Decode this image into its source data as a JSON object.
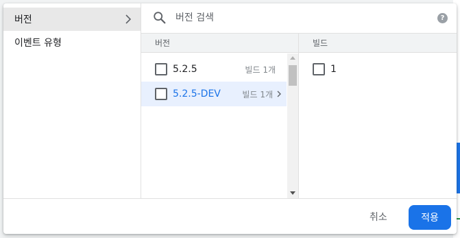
{
  "left_panel": {
    "items": [
      {
        "label": "버전"
      },
      {
        "label": "이벤트 유형"
      }
    ]
  },
  "search": {
    "placeholder": "버전 검색",
    "value": "",
    "help_glyph": "?"
  },
  "version_column": {
    "header": "버전",
    "rows": [
      {
        "label": "5.2.5",
        "count": "빌드 1개",
        "checked": false
      },
      {
        "label": "5.2.5-DEV",
        "count": "빌드 1개",
        "checked": false
      }
    ]
  },
  "build_column": {
    "header": "빌드",
    "rows": [
      {
        "label": "1",
        "checked": false
      }
    ]
  },
  "footer": {
    "cancel_label": "취소",
    "apply_label": "적용"
  },
  "colors": {
    "accent": "#1a73e8",
    "selected_row_bg": "#e8f0fe",
    "selected_category_bg": "#e8e8e8",
    "header_bg": "#f1f3f4"
  },
  "icons": {
    "search": "search-icon",
    "help": "help-icon",
    "chevron": "chevron-right-icon"
  }
}
